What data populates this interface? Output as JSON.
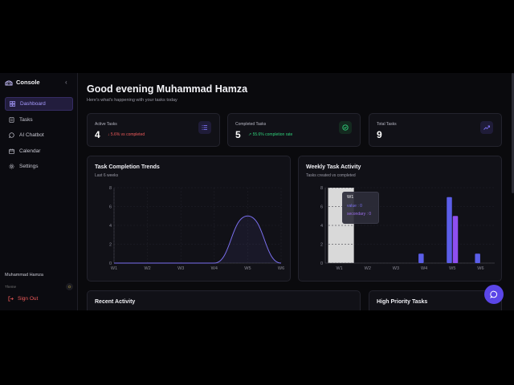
{
  "brand": {
    "title": "Console"
  },
  "sidebar": {
    "items": [
      {
        "label": "Dashboard",
        "icon": "dashboard-icon"
      },
      {
        "label": "Tasks",
        "icon": "tasks-icon"
      },
      {
        "label": "AI Chatbot",
        "icon": "chat-icon"
      },
      {
        "label": "Calendar",
        "icon": "calendar-icon"
      },
      {
        "label": "Settings",
        "icon": "gear-icon"
      }
    ],
    "active_index": 0,
    "user_name": "Muhammad Hamza",
    "theme_label": "Theme",
    "sign_out": "Sign Out"
  },
  "header": {
    "greeting": "Good evening Muhammad Hamza",
    "subtitle": "Here's what's happening with your tasks today"
  },
  "stats": [
    {
      "label": "Active Tasks",
      "value": "4",
      "trend": "↓ 5.6% vs completed",
      "trend_color": "#ef5a5a",
      "icon": "list-icon",
      "icon_color": "#7b70f0",
      "icon_bg": "#1f1c38"
    },
    {
      "label": "Completed Tasks",
      "value": "5",
      "trend": "↗ 55.6% completion rate",
      "trend_color": "#2fd07a",
      "icon": "check-circle-icon",
      "icon_color": "#2fd07a",
      "icon_bg": "#14291f"
    },
    {
      "label": "Total Tasks",
      "value": "9",
      "trend": "",
      "trend_color": "#888",
      "icon": "trend-up-icon",
      "icon_color": "#7b70f0",
      "icon_bg": "#1f1c38"
    }
  ],
  "charts": {
    "completion": {
      "title": "Task Completion Trends",
      "subtitle": "Last 6 weeks"
    },
    "weekly": {
      "title": "Weekly Task Activity",
      "subtitle": "Tasks created vs completed"
    }
  },
  "chart_data": [
    {
      "type": "area",
      "title": "Task Completion Trends",
      "categories": [
        "W1",
        "W2",
        "W3",
        "W4",
        "W5",
        "W6"
      ],
      "values": [
        0,
        0,
        0,
        0,
        5,
        0
      ],
      "ylim": [
        0,
        8
      ],
      "yticks": [
        0,
        2,
        4,
        6,
        8
      ],
      "color": "#7b70f0"
    },
    {
      "type": "bar",
      "title": "Weekly Task Activity",
      "categories": [
        "W1",
        "W2",
        "W3",
        "W4",
        "W5",
        "W6"
      ],
      "series": [
        {
          "name": "value",
          "values": [
            0,
            0,
            0,
            1,
            7,
            1
          ],
          "color": "#5b5ee8"
        },
        {
          "name": "secondary",
          "values": [
            0,
            0,
            0,
            0,
            5,
            0
          ],
          "color": "#8f4ff0"
        }
      ],
      "ylim": [
        0,
        8
      ],
      "yticks": [
        0,
        2,
        4,
        6,
        8
      ],
      "highlight_index": 0,
      "tooltip": {
        "label": "W1",
        "line1": "value : 0",
        "line2": "secondary : 0"
      }
    }
  ],
  "bottom": {
    "recent": "Recent Activity",
    "priority": "High Priority Tasks"
  }
}
